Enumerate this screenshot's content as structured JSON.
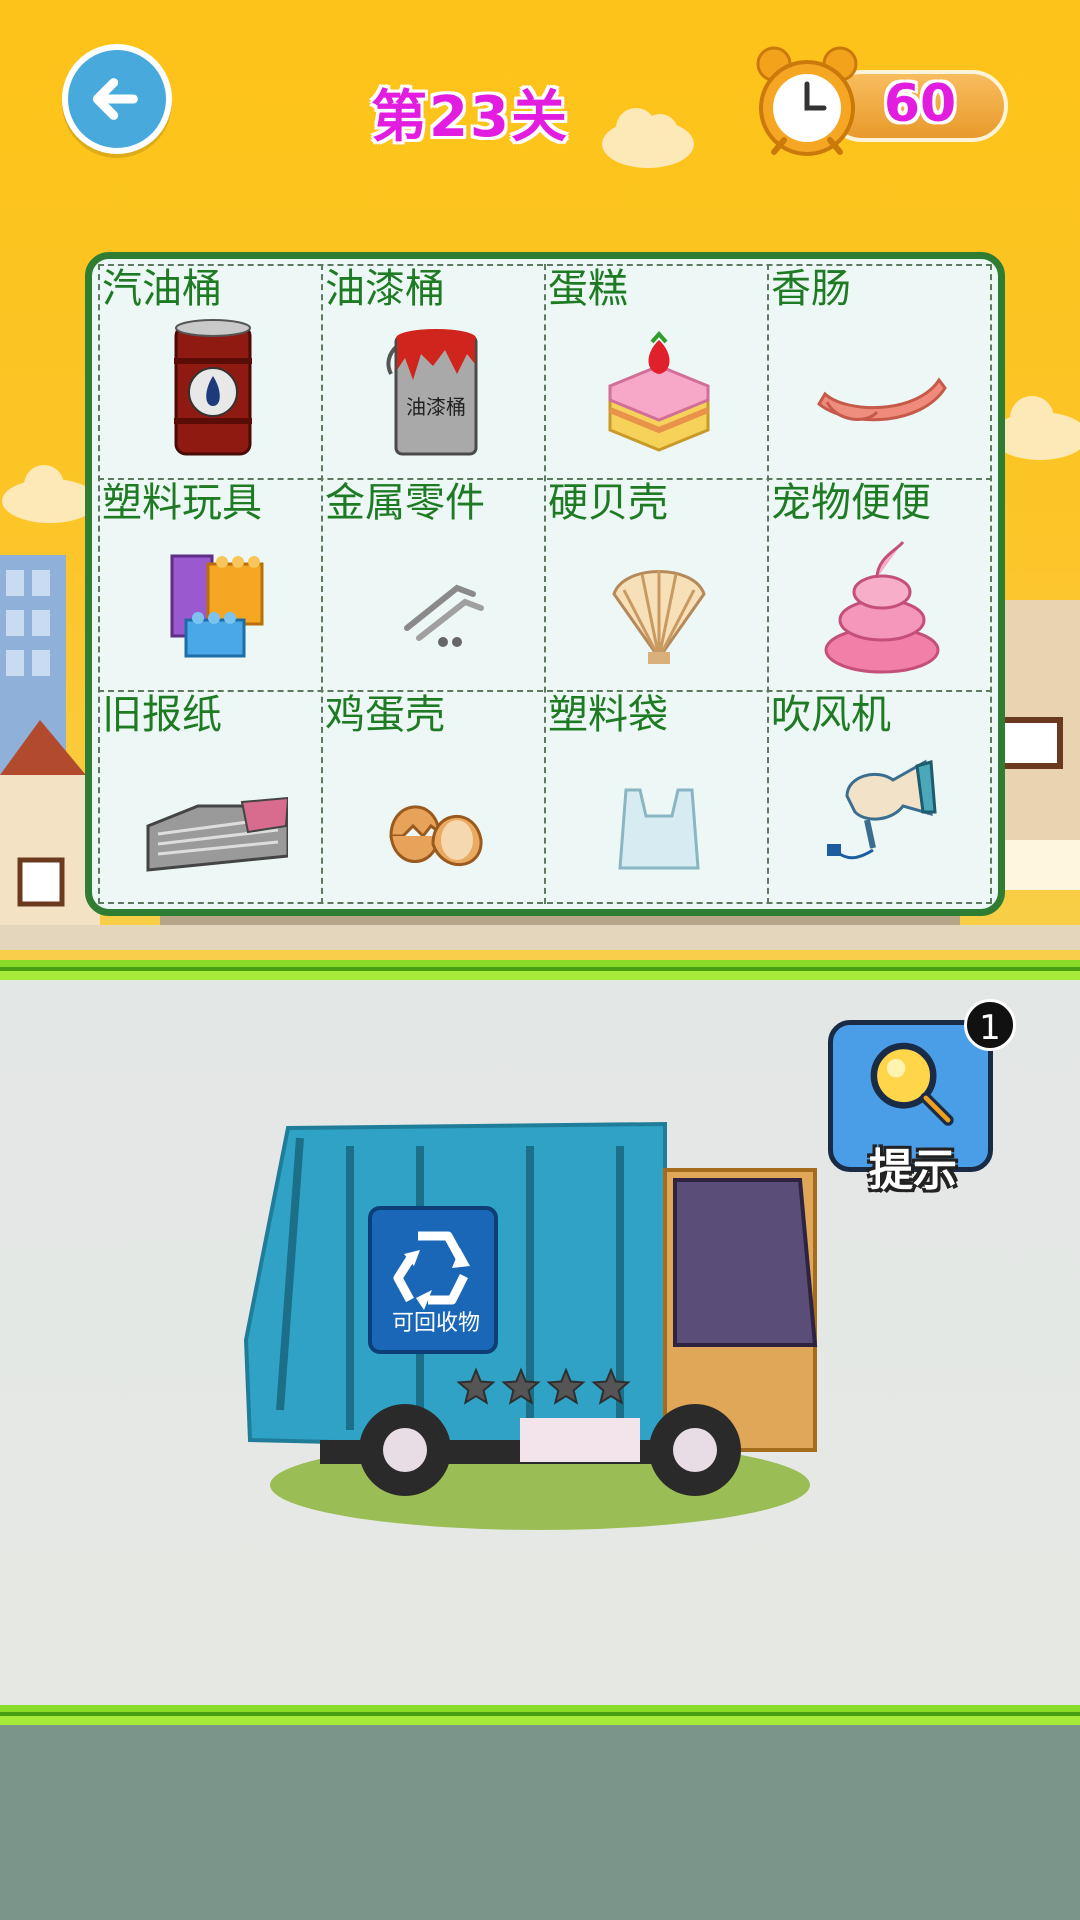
{
  "header": {
    "back_icon": "arrow-left-icon",
    "level_title": "第23关",
    "timer_icon": "alarm-clock-icon",
    "timer_value": "60"
  },
  "items": [
    {
      "label": "汽油桶",
      "icon": "oil-drum-icon"
    },
    {
      "label": "油漆桶",
      "icon": "paint-bucket-icon"
    },
    {
      "label": "蛋糕",
      "icon": "cake-icon"
    },
    {
      "label": "香肠",
      "icon": "sausage-icon"
    },
    {
      "label": "塑料玩具",
      "icon": "plastic-blocks-icon"
    },
    {
      "label": "金属零件",
      "icon": "metal-parts-icon"
    },
    {
      "label": "硬贝壳",
      "icon": "shell-icon"
    },
    {
      "label": "宠物便便",
      "icon": "poop-icon"
    },
    {
      "label": "旧报纸",
      "icon": "newspaper-icon"
    },
    {
      "label": "鸡蛋壳",
      "icon": "eggshell-icon"
    },
    {
      "label": "塑料袋",
      "icon": "plastic-bag-icon"
    },
    {
      "label": "吹风机",
      "icon": "hair-dryer-icon"
    }
  ],
  "paint_bucket_text": "油漆桶",
  "hint": {
    "label": "提示",
    "count": "1",
    "icon": "magnifier-icon"
  },
  "truck": {
    "bin_label": "可回收物",
    "stars": 4,
    "icon": "recycle-icon"
  },
  "colors": {
    "sky": "#fdc318",
    "panel_border": "#2e7d32",
    "label_text": "#1e7b23",
    "level_text": "#e31de0",
    "truck_blue": "#2fa2c5"
  }
}
